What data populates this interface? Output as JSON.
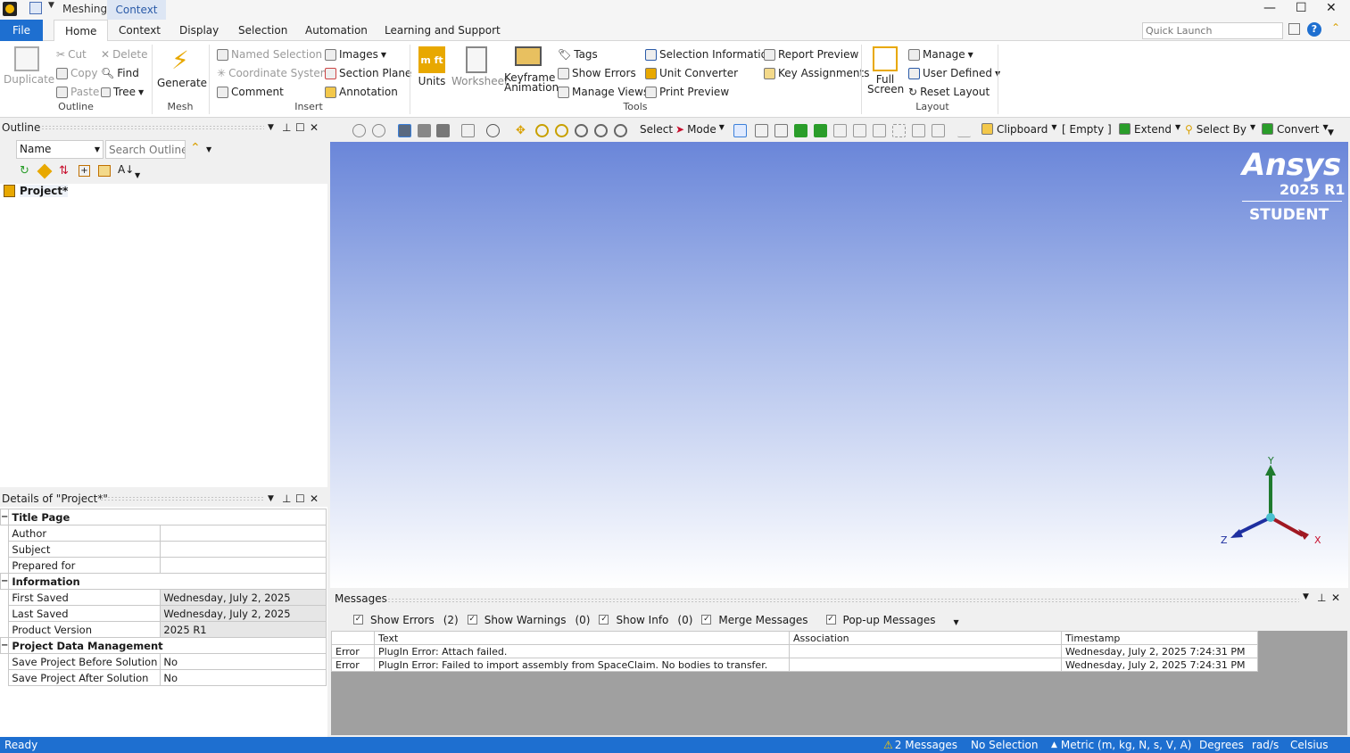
{
  "titlebar": {
    "app_name": "Meshing",
    "context_tab": "Context",
    "minimize": "—",
    "maximize": "☐",
    "close": "✕"
  },
  "tabs": [
    "File",
    "Home",
    "Context",
    "Display",
    "Selection",
    "Automation",
    "Learning and Support"
  ],
  "quick_launch": {
    "placeholder": "Quick Launch"
  },
  "ribbon": {
    "duplicate": "Duplicate",
    "cut": "Cut",
    "copy": "Copy",
    "paste": "Paste",
    "delete": "Delete",
    "find": "Find",
    "tree": "Tree",
    "outline_group": "Outline",
    "generate": "Generate",
    "mesh_group": "Mesh",
    "named_selection": "Named Selection",
    "coordinate_system": "Coordinate System",
    "comment": "Comment",
    "images": "Images",
    "section_plane": "Section Plane",
    "annotation": "Annotation",
    "insert_group": "Insert",
    "units": "Units",
    "worksheet": "Worksheet",
    "keyframe": "Keyframe",
    "animation": "Animation",
    "tags": "Tags",
    "show_errors": "Show Errors",
    "manage_views": "Manage Views",
    "selection_information": "Selection Information",
    "unit_converter": "Unit Converter",
    "print_preview": "Print Preview",
    "report_preview": "Report Preview",
    "key_assignments": "Key Assignments",
    "tools_group": "Tools",
    "full": "Full",
    "screen": "Screen",
    "manage": "Manage",
    "user_defined": "User Defined",
    "reset_layout": "Reset Layout",
    "layout_group": "Layout"
  },
  "outline": {
    "title": "Outline",
    "name_select": "Name",
    "search_placeholder": "Search Outline",
    "root": "Project*"
  },
  "viewport_toolbar": {
    "select": "Select",
    "mode": "Mode",
    "clipboard": "Clipboard",
    "empty": "[ Empty ]",
    "extend": "Extend",
    "select_by": "Select By",
    "convert": "Convert"
  },
  "branding": {
    "name": "Ansys",
    "version": "2025 R1",
    "edition": "STUDENT"
  },
  "triad": {
    "y": "Y",
    "x": "X",
    "z": "Z"
  },
  "details": {
    "title": "Details of \"Project*\"",
    "sections": [
      {
        "name": "Title Page",
        "rows": [
          [
            "Author",
            ""
          ],
          [
            "Subject",
            ""
          ],
          [
            "Prepared for",
            ""
          ]
        ]
      },
      {
        "name": "Information",
        "rows": [
          [
            "First Saved",
            "Wednesday, July 2, 2025"
          ],
          [
            "Last Saved",
            "Wednesday, July 2, 2025"
          ],
          [
            "Product Version",
            "2025 R1"
          ]
        ]
      },
      {
        "name": "Project Data Management",
        "rows": [
          [
            "Save Project Before Solution",
            "No"
          ],
          [
            "Save Project After Solution",
            "No"
          ]
        ]
      }
    ]
  },
  "messages": {
    "title": "Messages",
    "filters": [
      {
        "label": "Show Errors",
        "count": "(2)"
      },
      {
        "label": "Show Warnings",
        "count": "(0)"
      },
      {
        "label": "Show Info",
        "count": "(0)"
      },
      {
        "label": "Merge Messages",
        "count": ""
      },
      {
        "label": "Pop-up Messages",
        "count": ""
      }
    ],
    "columns": [
      "",
      "Text",
      "Association",
      "Timestamp"
    ],
    "rows": [
      [
        "Error",
        "PlugIn Error: Attach failed.",
        "",
        "Wednesday, July 2, 2025 7:24:31 PM"
      ],
      [
        "Error",
        "PlugIn Error: Failed to import assembly from SpaceClaim. No bodies to transfer.",
        "",
        "Wednesday, July 2, 2025 7:24:31 PM"
      ]
    ]
  },
  "statusbar": {
    "ready": "Ready",
    "messages": "2 Messages",
    "selection": "No Selection",
    "units": "Metric (m, kg, N, s, V, A)",
    "degrees": "Degrees",
    "rads": "rad/s",
    "temp": "Celsius"
  },
  "colors": {
    "accent": "#1e6fd0",
    "error_red": "#c8102e"
  }
}
